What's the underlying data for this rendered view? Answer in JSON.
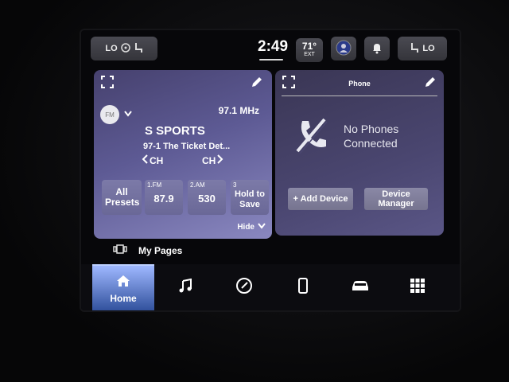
{
  "topbar": {
    "left_pill_label": "LO",
    "clock": "2:49",
    "temperature": "71°",
    "temperature_unit": "EXT",
    "right_pill_label": "LO"
  },
  "radio": {
    "band": "FM",
    "frequency": "97.1 MHz",
    "station_name": "S SPORTS",
    "program": "97-1 The Ticket Det...",
    "ch_prev": "CH",
    "ch_next": "CH",
    "all_presets": "All Presets",
    "presets": [
      {
        "tag": "1.FM",
        "value": "87.9"
      },
      {
        "tag": "2.AM",
        "value": "530"
      },
      {
        "tag": "3",
        "value": "Hold to Save"
      }
    ],
    "hide_label": "Hide"
  },
  "phone": {
    "title": "Phone",
    "status_line1": "No Phones",
    "status_line2": "Connected",
    "add_device": "+ Add Device",
    "device_manager": "Device Manager"
  },
  "my_pages": "My Pages",
  "nav": {
    "home_label": "Home",
    "items": [
      "music-icon",
      "navigation-icon",
      "phone-icon",
      "vehicle-icon",
      "apps-grid-icon"
    ]
  },
  "colors": {
    "radio_card": "#5d5a94",
    "phone_card": "#4a4670",
    "home_active": "#2e4e9a"
  }
}
